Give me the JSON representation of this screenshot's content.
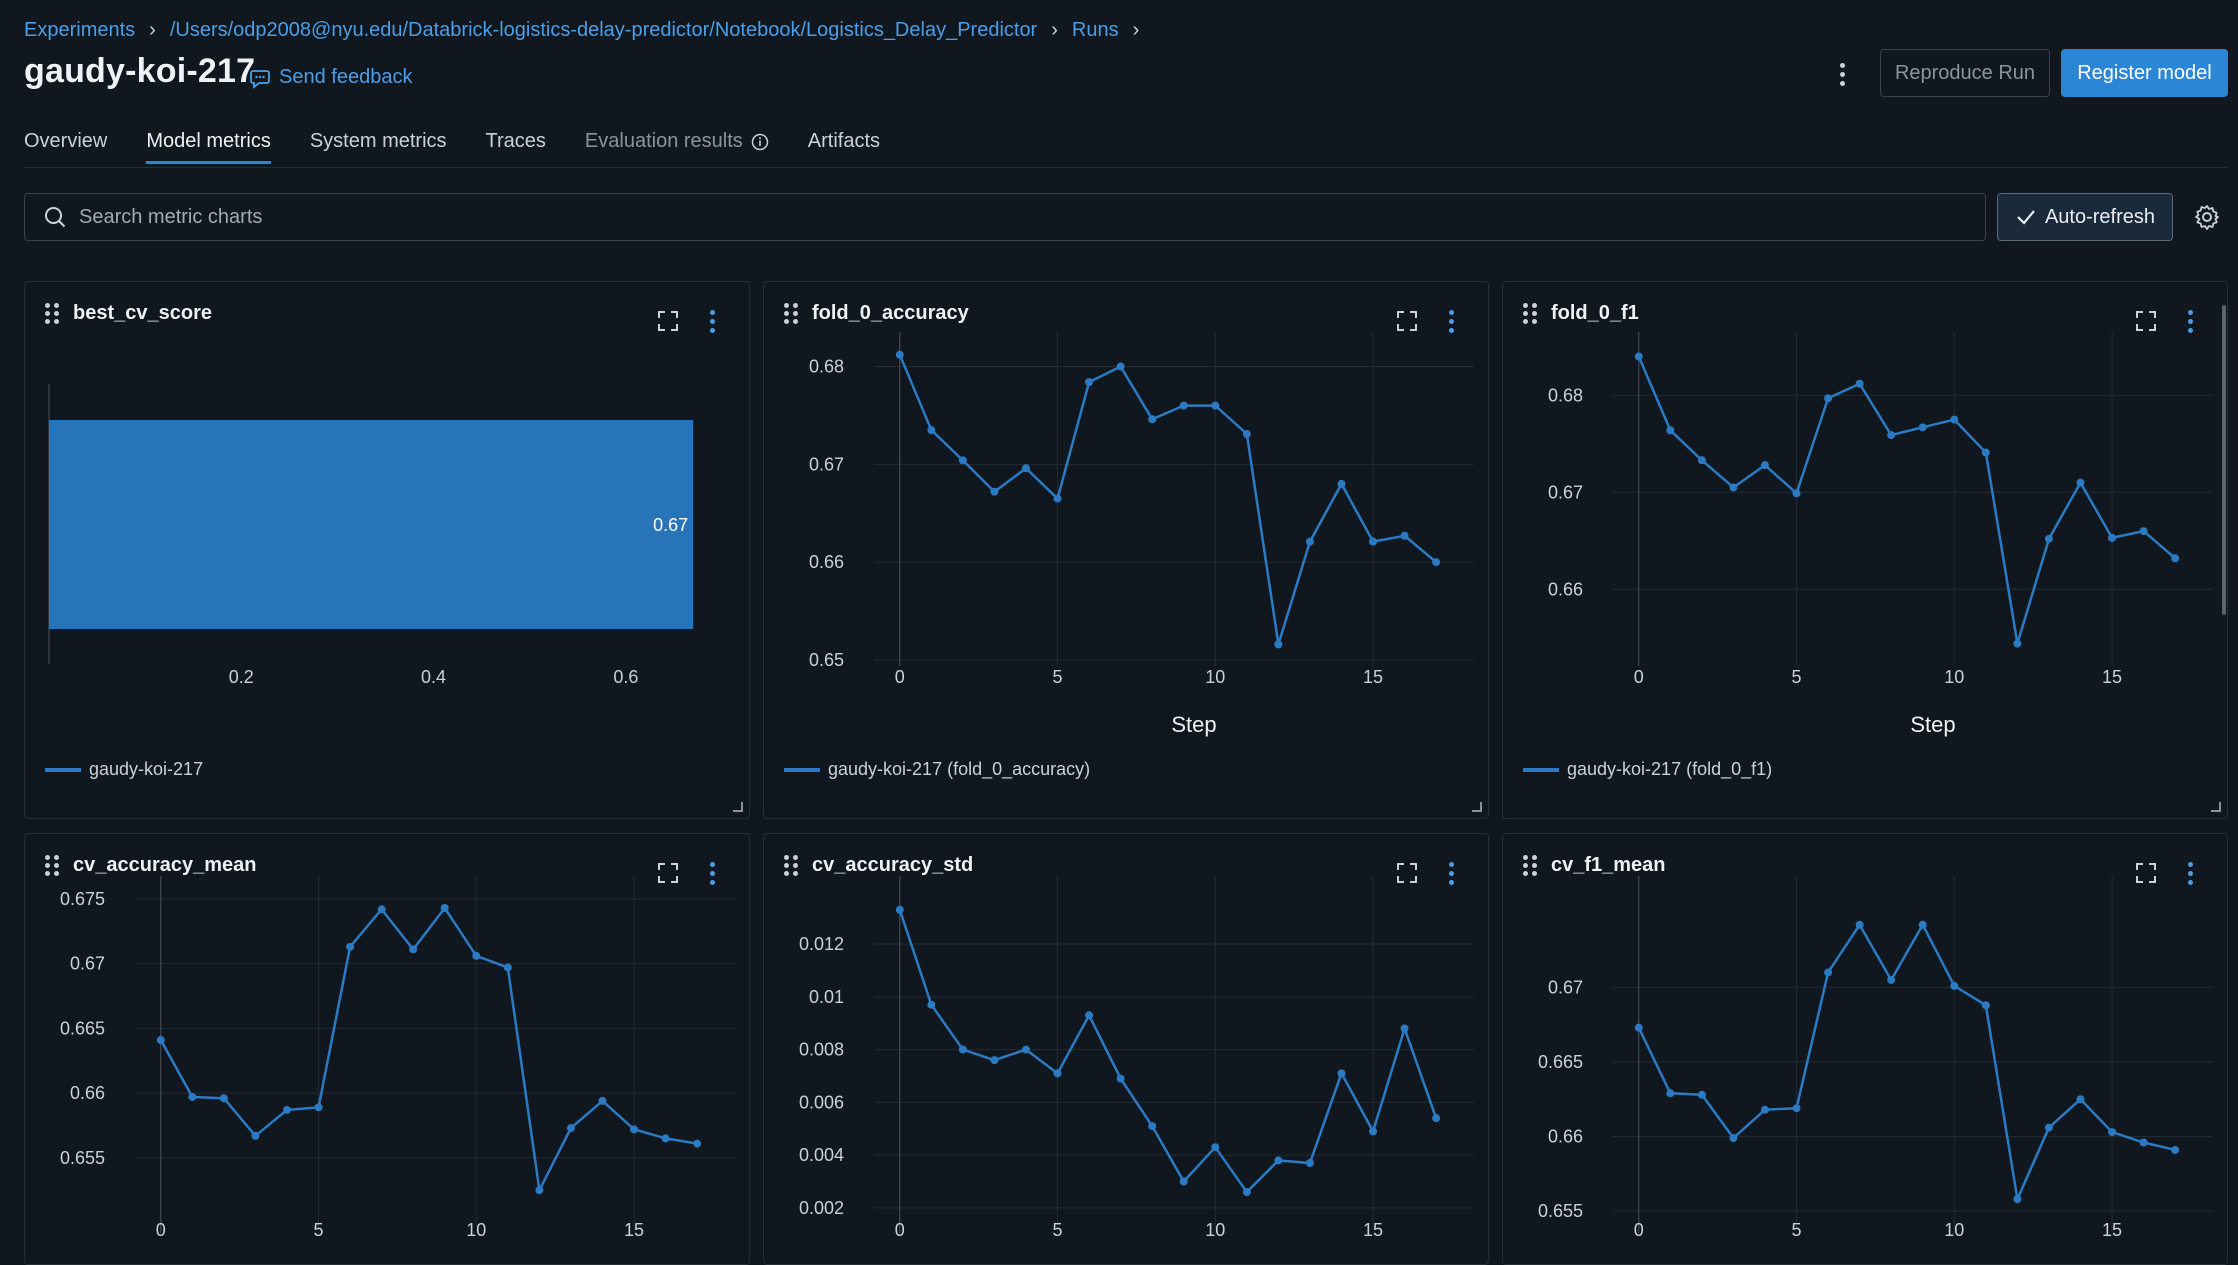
{
  "breadcrumb": {
    "items": [
      "Experiments",
      "/Users/odp2008@nyu.edu/Databrick-logistics-delay-predictor/Notebook/Logistics_Delay_Predictor",
      "Runs"
    ]
  },
  "header": {
    "title": "gaudy-koi-217",
    "feedback_label": "Send feedback",
    "reproduce_label": "Reproduce Run",
    "register_label": "Register model"
  },
  "tabs": [
    {
      "label": "Overview"
    },
    {
      "label": "Model metrics",
      "active": true
    },
    {
      "label": "System metrics"
    },
    {
      "label": "Traces"
    },
    {
      "label": "Evaluation results",
      "disabled": true
    },
    {
      "label": "Artifacts"
    }
  ],
  "search": {
    "placeholder": "Search metric charts",
    "value": ""
  },
  "toolbar": {
    "autorefresh_label": "Auto-refresh"
  },
  "colors": {
    "accent": "#2b86d6",
    "series": "#2b7bc4",
    "background": "#11171e"
  },
  "charts": [
    {
      "title": "best_cv_score",
      "legend": "gaudy-koi-217",
      "chart_data": {
        "type": "bar",
        "orientation": "horizontal",
        "categories": [
          "gaudy-koi-217"
        ],
        "values": [
          0.67
        ],
        "data_label": "0.67",
        "xticks": [
          "0.2",
          "0.4",
          "0.6"
        ],
        "xlim": [
          0,
          0.7
        ],
        "grid": false
      }
    },
    {
      "title": "fold_0_accuracy",
      "legend": "gaudy-koi-217 (fold_0_accuracy)",
      "chart_data": {
        "type": "line",
        "x": [
          0,
          1,
          2,
          3,
          4,
          5,
          6,
          7,
          8,
          9,
          10,
          11,
          12,
          13,
          14,
          15,
          16,
          17
        ],
        "series": [
          {
            "name": "gaudy-koi-217 (fold_0_accuracy)",
            "values": [
              0.6812,
              0.6735,
              0.6704,
              0.6672,
              0.6696,
              0.6665,
              0.6784,
              0.68,
              0.6746,
              0.676,
              0.676,
              0.6731,
              0.6516,
              0.6621,
              0.668,
              0.6621,
              0.6627,
              0.66
            ]
          }
        ],
        "xlabel": "Step",
        "xticks": [
          "0",
          "5",
          "10",
          "15"
        ],
        "yticks": [
          "0.65",
          "0.66",
          "0.67",
          "0.68"
        ],
        "xlim": [
          -0.5,
          18.2
        ],
        "ylim": [
          0.6498,
          0.6825
        ],
        "grid": true
      }
    },
    {
      "title": "fold_0_f1",
      "legend": "gaudy-koi-217 (fold_0_f1)",
      "chart_data": {
        "type": "line",
        "x": [
          0,
          1,
          2,
          3,
          4,
          5,
          6,
          7,
          8,
          9,
          10,
          11,
          12,
          13,
          14,
          15,
          16,
          17
        ],
        "series": [
          {
            "name": "gaudy-koi-217 (fold_0_f1)",
            "values": [
              0.684,
              0.6764,
              0.6733,
              0.6705,
              0.6728,
              0.6699,
              0.6797,
              0.6812,
              0.6759,
              0.6767,
              0.6775,
              0.6741,
              0.6544,
              0.6652,
              0.671,
              0.6653,
              0.666,
              0.6632
            ]
          }
        ],
        "xlabel": "Step",
        "xticks": [
          "0",
          "5",
          "10",
          "15"
        ],
        "yticks": [
          "0.66",
          "0.67",
          "0.68"
        ],
        "xlim": [
          -0.5,
          18.2
        ],
        "ylim": [
          0.6525,
          0.6855
        ],
        "grid": true
      }
    },
    {
      "title": "cv_accuracy_mean",
      "legend": "",
      "chart_data": {
        "type": "line",
        "x": [
          0,
          1,
          2,
          3,
          4,
          5,
          6,
          7,
          8,
          9,
          10,
          11,
          12,
          13,
          14,
          15,
          16,
          17
        ],
        "series": [
          {
            "name": "",
            "values": [
              0.6641,
              0.6597,
              0.6596,
              0.6567,
              0.6587,
              0.6589,
              0.6713,
              0.6742,
              0.6711,
              0.6743,
              0.6706,
              0.6697,
              0.6525,
              0.6573,
              0.6594,
              0.6572,
              0.6565,
              0.6561
            ]
          }
        ],
        "xticks": [
          "0",
          "5",
          "10",
          "15"
        ],
        "yticks": [
          "0.655",
          "0.66",
          "0.665",
          "0.67",
          "0.675"
        ],
        "xlim": [
          -0.5,
          18.2
        ],
        "ylim": [
          0.6495,
          0.676
        ],
        "grid": true
      }
    },
    {
      "title": "cv_accuracy_std",
      "legend": "",
      "chart_data": {
        "type": "line",
        "x": [
          0,
          1,
          2,
          3,
          4,
          5,
          6,
          7,
          8,
          9,
          10,
          11,
          12,
          13,
          14,
          15,
          16,
          17
        ],
        "series": [
          {
            "name": "",
            "values": [
              0.0133,
              0.0097,
              0.008,
              0.0076,
              0.008,
              0.0071,
              0.0093,
              0.0069,
              0.0051,
              0.003,
              0.0043,
              0.0026,
              0.0038,
              0.0037,
              0.0071,
              0.0049,
              0.0088,
              0.0054
            ]
          }
        ],
        "xticks": [
          "0",
          "5",
          "10",
          "15"
        ],
        "yticks": [
          "0.002",
          "0.004",
          "0.006",
          "0.008",
          "0.01",
          "0.012"
        ],
        "xlim": [
          -0.5,
          18.2
        ],
        "ylim": [
          0.0012,
          0.0142
        ],
        "grid": true
      }
    },
    {
      "title": "cv_f1_mean",
      "legend": "",
      "chart_data": {
        "type": "line",
        "x": [
          0,
          1,
          2,
          3,
          4,
          5,
          6,
          7,
          8,
          9,
          10,
          11,
          12,
          13,
          14,
          15,
          16,
          17
        ],
        "series": [
          {
            "name": "",
            "values": [
              0.6673,
              0.6629,
              0.6628,
              0.6599,
              0.6618,
              0.6619,
              0.671,
              0.6742,
              0.6705,
              0.6742,
              0.6701,
              0.6688,
              0.6558,
              0.6606,
              0.6625,
              0.6603,
              0.6596,
              0.6591
            ]
          }
        ],
        "xticks": [
          "0",
          "5",
          "10",
          "15"
        ],
        "yticks": [
          "0.655",
          "0.66",
          "0.665",
          "0.67"
        ],
        "xlim": [
          -0.5,
          18.2
        ],
        "ylim": [
          0.6538,
          0.6768
        ],
        "grid": true
      }
    }
  ]
}
